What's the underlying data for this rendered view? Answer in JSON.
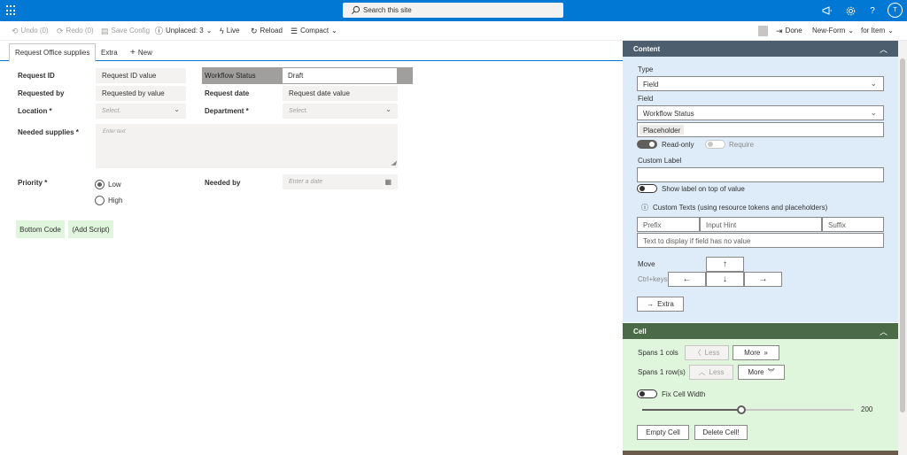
{
  "suite": {
    "search_placeholder": "Search this site",
    "avatar_initial": "T"
  },
  "toolbar": {
    "undo": "Undo (0)",
    "redo": "Redo (0)",
    "save_config": "Save Config",
    "unplaced": "Unplaced: 3",
    "live": "Live",
    "reload": "Reload",
    "compact": "Compact",
    "done": "Done",
    "new_form": "New-Form",
    "for_item": "for Item"
  },
  "tabs": {
    "request": "Request Office supplies",
    "extra": "Extra",
    "new": "New"
  },
  "form": {
    "request_id_label": "Request ID",
    "request_id_value": "Request ID value",
    "workflow_status_label": "Workflow Status",
    "workflow_status_value": "Draft",
    "requested_by_label": "Requested by",
    "requested_by_value": "Requested by value",
    "request_date_label": "Request date",
    "request_date_value": "Request date value",
    "location_label": "Location *",
    "location_placeholder": "Select.",
    "department_label": "Department *",
    "department_placeholder": "Select.",
    "needed_supplies_label": "Needed supplies *",
    "needed_supplies_placeholder": "Enter text",
    "priority_label": "Priority *",
    "priority_options": [
      "Low",
      "High"
    ],
    "priority_selected": "Low",
    "needed_by_label": "Needed by",
    "needed_by_placeholder": "Enter a date",
    "bottom_code": "Bottom Code",
    "add_script": "(Add Script)"
  },
  "panel": {
    "content_title": "Content",
    "type_label": "Type",
    "type_value": "Field",
    "field_label": "Field",
    "field_value": "Workflow Status",
    "placeholder_value": "Placeholder",
    "readonly_label": "Read-only",
    "require_label": "Require",
    "custom_label_label": "Custom Label",
    "custom_label_value": "",
    "show_label_top": "Show label on top of value",
    "custom_texts": "Custom Texts (using resource tokens and placeholders)",
    "prefix": "Prefix",
    "input_hint": "Input Hint",
    "suffix": "Suffix",
    "no_value_text": "Text to display if field has no value",
    "move_label": "Move",
    "ctrl_keys": "Ctrl+keys",
    "extra_button": "Extra",
    "cell_title": "Cell",
    "spans_cols": "Spans 1 cols",
    "spans_rows": "Spans 1 row(s)",
    "less": "Less",
    "more": "More",
    "fix_cell_width": "Fix Cell Width",
    "cell_width_value": "200",
    "cell_width_fraction": 0.47,
    "empty_cell": "Empty Cell",
    "delete_cell": "Delete Cell!"
  },
  "colors": {
    "suite_blue": "#0078d4",
    "content_header": "#4d5f6e",
    "content_bg": "#deecf9",
    "cell_header": "#4b6b48",
    "cell_bg": "#dff6dd",
    "green_button": "#dff6dd"
  }
}
